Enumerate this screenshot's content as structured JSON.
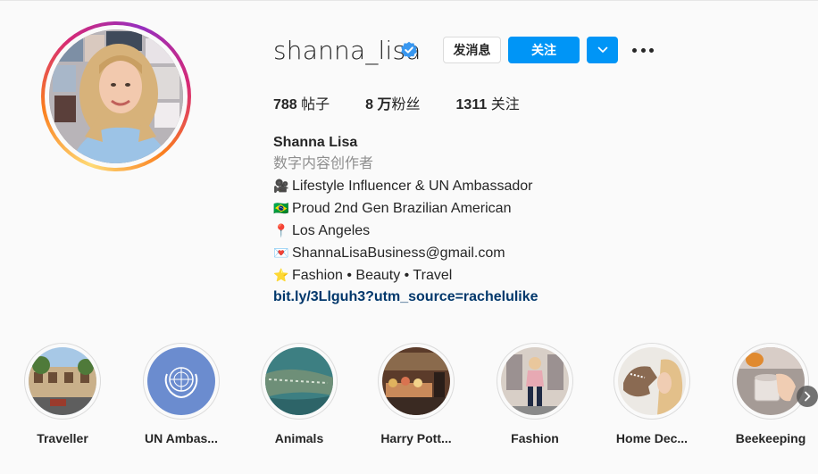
{
  "profile": {
    "username": "shanna_lisa",
    "verified": true,
    "buttons": {
      "message": "发消息",
      "follow": "关注"
    },
    "stats": {
      "posts_value": "788",
      "posts_label": " 帖子",
      "followers_value": "8 万",
      "followers_label": "粉丝",
      "following_value": "1311",
      "following_label": " 关注"
    },
    "bio": {
      "name": "Shanna Lisa",
      "category": "数字内容创作者",
      "lines": [
        {
          "emoji": "🎥",
          "text": "Lifestyle Influencer & UN Ambassador"
        },
        {
          "emoji": "🇧🇷",
          "text": "Proud 2nd Gen Brazilian American"
        },
        {
          "emoji": "📍",
          "text": "Los Angeles"
        },
        {
          "emoji": "💌",
          "text": "ShannaLisaBusiness@gmail.com"
        },
        {
          "emoji": "⭐",
          "text": "Fashion • Beauty • Travel"
        }
      ],
      "link": "bit.ly/3Llguh3?utm_source=rachelulike"
    }
  },
  "highlights": [
    {
      "label": "Traveller"
    },
    {
      "label": "UN Ambas..."
    },
    {
      "label": "Animals"
    },
    {
      "label": "Harry Pott..."
    },
    {
      "label": "Fashion"
    },
    {
      "label": "Home Dec..."
    },
    {
      "label": "Beekeeping"
    }
  ],
  "colors": {
    "primary_blue": "#0095f6",
    "link_blue": "#00376b",
    "text": "#262626",
    "secondary_text": "#8e8e8e",
    "verified_blue": "#3897f0"
  },
  "icons": {
    "verified": "verified-badge-icon",
    "chevron": "chevron-down-icon",
    "more": "more-options-icon",
    "next": "chevron-right-icon"
  }
}
